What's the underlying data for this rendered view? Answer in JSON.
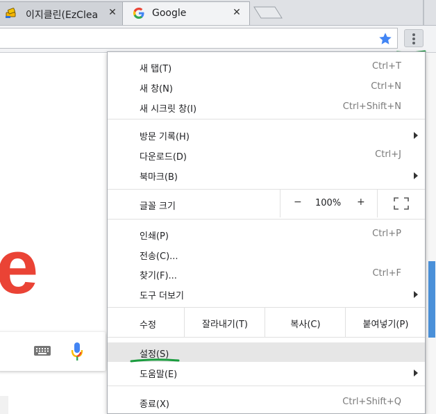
{
  "tabs": [
    {
      "title": "이지클린(EzClea",
      "close": "✕"
    },
    {
      "title": "Google",
      "close": "✕"
    }
  ],
  "menu": {
    "group1": [
      {
        "label": "새 탭(T)",
        "shortcut": "Ctrl+T"
      },
      {
        "label": "새 창(N)",
        "shortcut": "Ctrl+N"
      },
      {
        "label": "새 시크릿 창(I)",
        "shortcut": "Ctrl+Shift+N"
      }
    ],
    "group2": [
      {
        "label": "방문 기록(H)",
        "shortcut": ""
      },
      {
        "label": "다운로드(D)",
        "shortcut": "Ctrl+J"
      },
      {
        "label": "북마크(B)",
        "shortcut": ""
      }
    ],
    "zoom": {
      "label": "글꼴 크기",
      "minus": "−",
      "value": "100%",
      "plus": "+"
    },
    "group3": [
      {
        "label": "인쇄(P)",
        "shortcut": "Ctrl+P"
      },
      {
        "label": "전송(C)...",
        "shortcut": ""
      },
      {
        "label": "찾기(F)...",
        "shortcut": "Ctrl+F"
      },
      {
        "label": "도구 더보기",
        "shortcut": ""
      }
    ],
    "edit": {
      "label": "수정",
      "cut": "잘라내기(T)",
      "copy": "복사(C)",
      "paste": "붙여넣기(P)"
    },
    "group4": [
      {
        "label": "설정(S)",
        "shortcut": ""
      },
      {
        "label": "도움말(E)",
        "shortcut": ""
      }
    ],
    "group5": [
      {
        "label": "종료(X)",
        "shortcut": "Ctrl+Shift+Q"
      }
    ]
  },
  "page": {
    "letter": "e"
  },
  "colors": {
    "accent_green": "#1a9c3e",
    "star_blue": "#4285f4",
    "google_red": "#ea4335"
  }
}
